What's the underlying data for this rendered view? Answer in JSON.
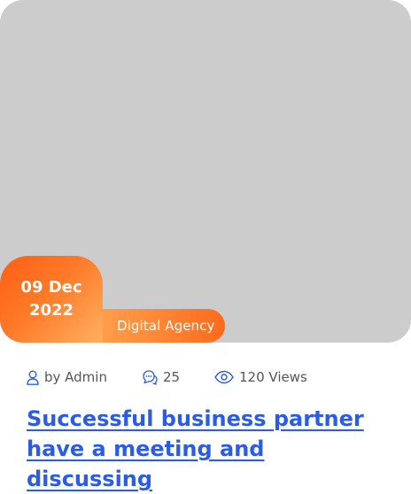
{
  "post": {
    "date": {
      "day_month": "09 Dec",
      "year": "2022"
    },
    "category": "Digital Agency",
    "author": "by Admin",
    "comments": "25",
    "views": "120 Views",
    "title": "Successful business partner have a meeting and discussing"
  },
  "icons": {
    "author": "user-icon",
    "comments": "chat-bubbles-icon",
    "views": "eye-icon"
  },
  "colors": {
    "accent_orange": "#ff6a1a",
    "title_blue": "#2b5ce6",
    "thumbnail_gray": "#cccccc"
  }
}
